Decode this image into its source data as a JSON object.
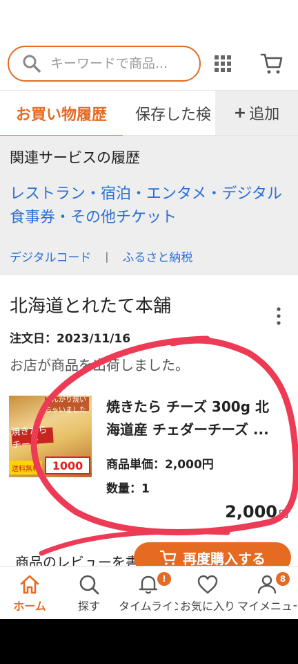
{
  "search": {
    "placeholder": "キーワードで商品..."
  },
  "tabs": {
    "purchase_history": "お買い物履歴",
    "saved": "保存した検",
    "add": "追加",
    "add_prefix": "+"
  },
  "related": {
    "title": "関連サービスの履歴",
    "link": "レストラン・宿泊・エンタメ・デジタル食事券・その他チケット",
    "sub_links": [
      "デジタルコード",
      "ふるさと納税"
    ],
    "separator": "|"
  },
  "order": {
    "shop_name": "北海道とれたて本舗",
    "order_date": "注文日：2023/11/16",
    "status": "お店が商品を出荷しました。",
    "product_line1": "焼きたら チーズ 300g 北",
    "product_line2": "海道産 チェダーチーズ ...",
    "unit_price": "商品単価：2,000円",
    "quantity": "数量：1",
    "total": "2,000",
    "total_unit": "円",
    "thumbnail_tags": [
      "焼きたらチーズ",
      "1000",
      "送料無料",
      "こんがり焼いちゃいました"
    ],
    "review_text": "商品のレビューを書く",
    "rebuy_label": "再度購入する"
  },
  "bottom_nav": [
    {
      "label": "ホーム",
      "icon": "home-icon",
      "active": true
    },
    {
      "label": "探す",
      "icon": "search-icon"
    },
    {
      "label": "タイムライン",
      "icon": "bell-icon",
      "badge": "!"
    },
    {
      "label": "お気に入り",
      "icon": "heart-icon"
    },
    {
      "label": "マイメニュー",
      "icon": "user-icon",
      "badge": "8"
    }
  ],
  "colors": {
    "accent": "#e56a22",
    "link": "#2a6fd6",
    "annotation": "#ee3b55"
  }
}
